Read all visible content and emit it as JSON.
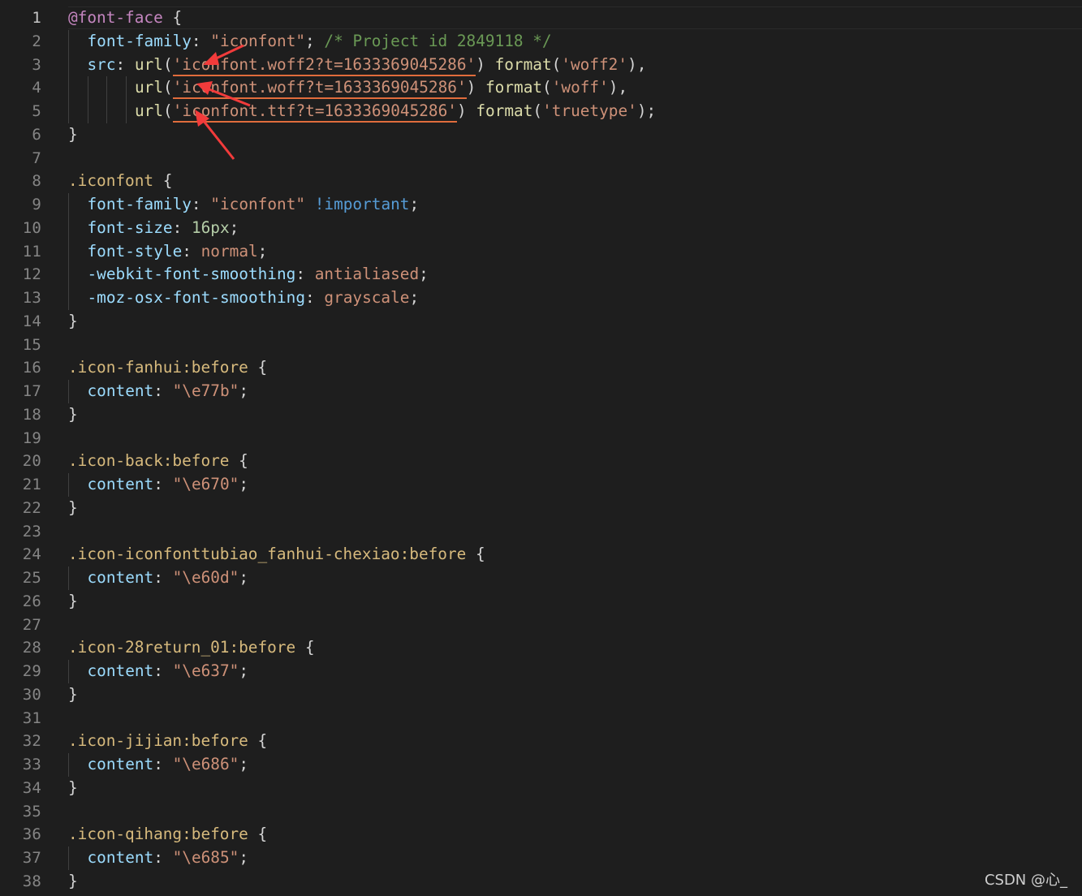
{
  "line_numbers": [
    "1",
    "2",
    "3",
    "4",
    "5",
    "6",
    "7",
    "8",
    "9",
    "10",
    "11",
    "12",
    "13",
    "14",
    "15",
    "16",
    "17",
    "18",
    "19",
    "20",
    "21",
    "22",
    "23",
    "24",
    "25",
    "26",
    "27",
    "28",
    "29",
    "30",
    "31",
    "32",
    "33",
    "34",
    "35",
    "36",
    "37",
    "38"
  ],
  "code": {
    "l1_at": "@font-face",
    "brace_open": "{",
    "brace_close": "}",
    "prop_font_family": "font-family",
    "colon": ":",
    "semi": ";",
    "iconfont_str": "\"iconfont\"",
    "comment": "/* Project id 2849118 */",
    "prop_src": "src",
    "url_fn": "url",
    "format_fn": "format",
    "paren_open": "(",
    "paren_close": ")",
    "comma": ",",
    "url_woff2": "'iconfont.woff2?t=1633369045286'",
    "url_woff": "'iconfont.woff?t=1633369045286'",
    "url_ttf": "'iconfont.ttf?t=1633369045286'",
    "fmt_woff2": "'woff2'",
    "fmt_woff": "'woff'",
    "fmt_truetype": "'truetype'",
    "sel_iconfont": ".iconfont",
    "important": "!important",
    "prop_font_size": "font-size",
    "val_16px": "16px",
    "prop_font_style": "font-style",
    "val_normal": "normal",
    "prop_webkit": "-webkit-font-smoothing",
    "val_antialiased": "antialiased",
    "prop_moz": "-moz-osx-font-smoothing",
    "val_grayscale": "grayscale",
    "prop_content": "content",
    "sel_fanhui": ".icon-fanhui:before",
    "val_e77b": "\"\\e77b\"",
    "sel_back": ".icon-back:before",
    "val_e670": "\"\\e670\"",
    "sel_chexiao": ".icon-iconfonttubiao_fanhui-chexiao:before",
    "val_e60d": "\"\\e60d\"",
    "sel_return": ".icon-28return_01:before",
    "val_e637": "\"\\e637\"",
    "sel_jijian": ".icon-jijian:before",
    "val_e686": "\"\\e686\"",
    "sel_qihang": ".icon-qihang:before",
    "val_e685": "\"\\e685\""
  },
  "watermark": "CSDN @心_",
  "colors": {
    "background": "#1e1e1e",
    "selector": "#d7ba7d",
    "property": "#9cdcfe",
    "string": "#ce9178",
    "comment": "#6a9955",
    "number": "#b5cea8",
    "keyword": "#569cd6",
    "annotation_arrow": "#f23b3b"
  }
}
